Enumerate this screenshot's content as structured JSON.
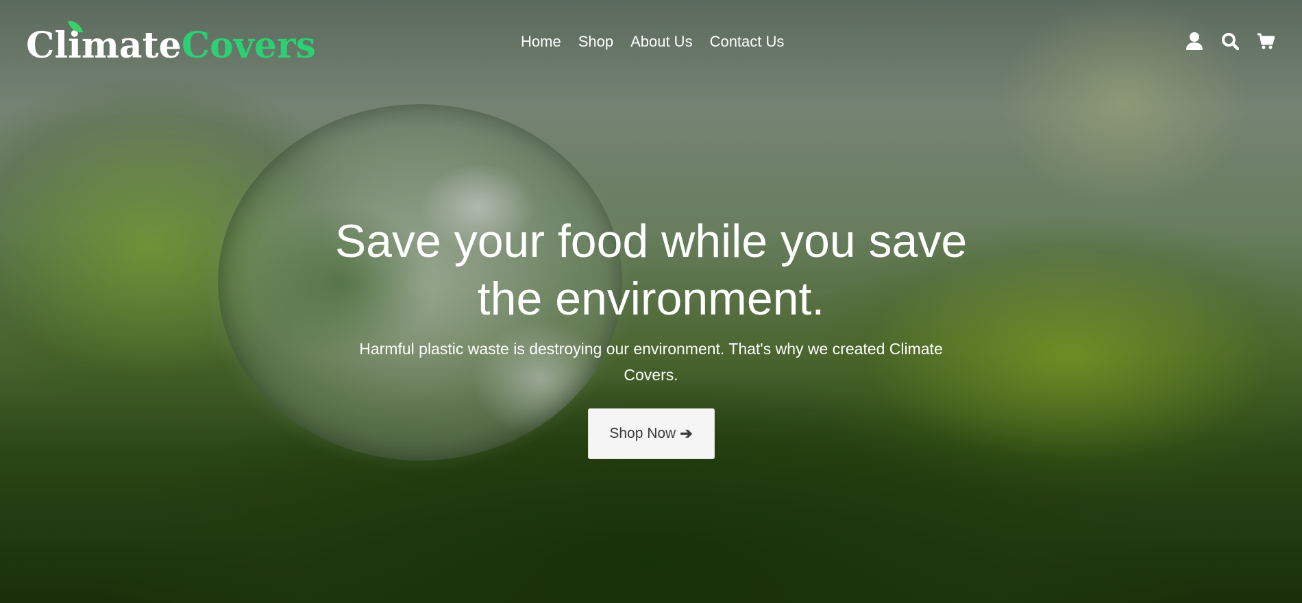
{
  "brand": {
    "name_part1": "Climate",
    "name_part2": "Covers",
    "accent_color": "#2ccf73"
  },
  "nav": {
    "items": [
      {
        "label": "Home"
      },
      {
        "label": "Shop"
      },
      {
        "label": "About Us"
      },
      {
        "label": "Contact Us"
      }
    ]
  },
  "header_icons": [
    {
      "icon": "user-icon"
    },
    {
      "icon": "search-icon"
    },
    {
      "icon": "cart-icon"
    }
  ],
  "hero": {
    "title": "Save your food while you save the environment.",
    "subtitle": "Harmful plastic waste is destroying our environment. That's why we created Climate Covers.",
    "cta_label": "Shop Now",
    "cta_icon": "arrow-right-icon"
  }
}
